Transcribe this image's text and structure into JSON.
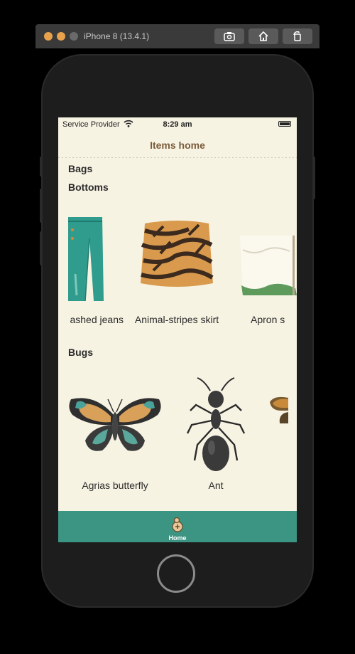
{
  "simulator": {
    "title": "iPhone 8 (13.4.1)"
  },
  "status_bar": {
    "carrier": "Service Provider",
    "time": "8:29 am"
  },
  "nav": {
    "title": "Items home"
  },
  "sections": {
    "bags": {
      "title": "Bags"
    },
    "bottoms": {
      "title": "Bottoms",
      "items": [
        {
          "label": "ashed jeans"
        },
        {
          "label": "Animal-stripes skirt"
        },
        {
          "label": "Apron s"
        }
      ]
    },
    "bugs": {
      "title": "Bugs",
      "items": [
        {
          "label": "Agrias butterfly"
        },
        {
          "label": "Ant"
        }
      ]
    }
  },
  "tabbar": {
    "items": [
      {
        "label": "Home"
      }
    ]
  },
  "colors": {
    "background": "#f7f3e3",
    "tabbar": "#3c9583",
    "nav_title": "#7a5b3a"
  }
}
